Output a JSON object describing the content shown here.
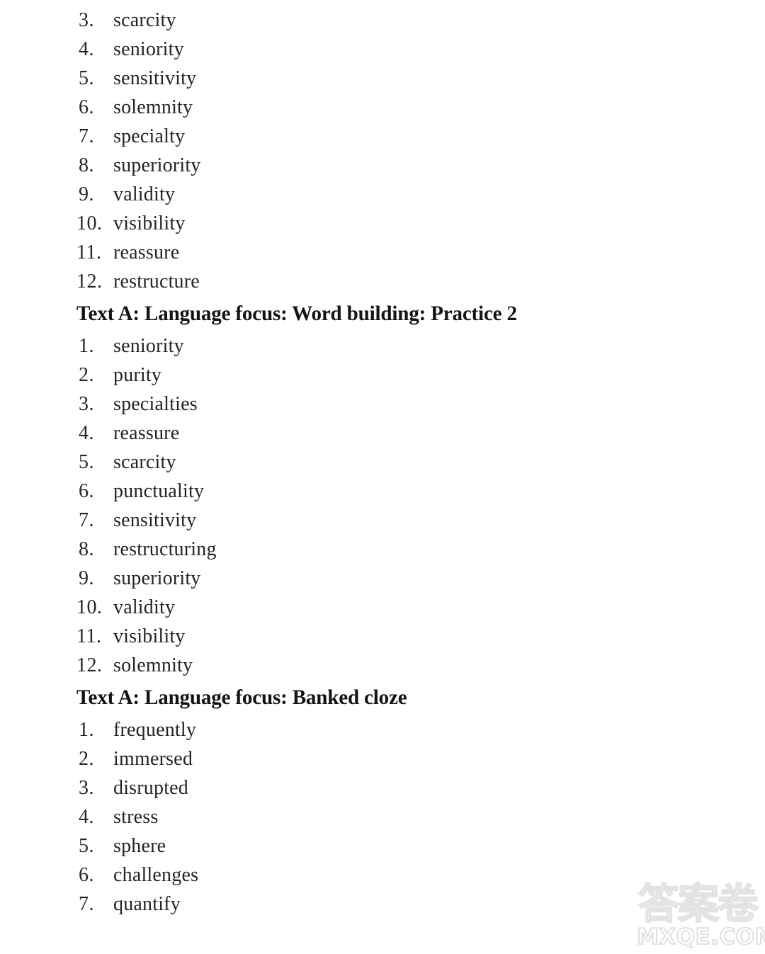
{
  "document": {
    "background_color": "#ffffff",
    "text_color": "#242424"
  },
  "blocks": [
    {
      "type": "list",
      "name": "word-building-practice-1-continued",
      "items": [
        {
          "number": "3.",
          "word": "scarcity"
        },
        {
          "number": "4.",
          "word": "seniority"
        },
        {
          "number": "5.",
          "word": "sensitivity"
        },
        {
          "number": "6.",
          "word": "solemnity"
        },
        {
          "number": "7.",
          "word": "specialty"
        },
        {
          "number": "8.",
          "word": "superiority"
        },
        {
          "number": "9.",
          "word": "validity"
        },
        {
          "number": "10.",
          "word": "visibility"
        },
        {
          "number": "11.",
          "word": "reassure"
        },
        {
          "number": "12.",
          "word": "restructure"
        }
      ]
    },
    {
      "type": "heading",
      "name": "heading-word-building-practice-2",
      "text": "Text A: Language focus: Word building: Practice 2"
    },
    {
      "type": "list",
      "name": "word-building-practice-2-answers",
      "items": [
        {
          "number": "1.",
          "word": "seniority"
        },
        {
          "number": "2.",
          "word": "purity"
        },
        {
          "number": "3.",
          "word": "specialties"
        },
        {
          "number": "4.",
          "word": "reassure"
        },
        {
          "number": "5.",
          "word": "scarcity"
        },
        {
          "number": "6.",
          "word": "punctuality"
        },
        {
          "number": "7.",
          "word": "sensitivity"
        },
        {
          "number": "8.",
          "word": "restructuring"
        },
        {
          "number": "9.",
          "word": "superiority"
        },
        {
          "number": "10.",
          "word": "validity"
        },
        {
          "number": "11.",
          "word": "visibility"
        },
        {
          "number": "12.",
          "word": "solemnity"
        }
      ]
    },
    {
      "type": "heading",
      "name": "heading-banked-cloze",
      "text": "Text A: Language focus: Banked cloze"
    },
    {
      "type": "list",
      "name": "banked-cloze-answers",
      "items": [
        {
          "number": "1.",
          "word": "frequently"
        },
        {
          "number": "2.",
          "word": "immersed"
        },
        {
          "number": "3.",
          "word": "disrupted"
        },
        {
          "number": "4.",
          "word": "stress"
        },
        {
          "number": "5.",
          "word": "sphere"
        },
        {
          "number": "6.",
          "word": "challenges"
        },
        {
          "number": "7.",
          "word": "quantify"
        }
      ]
    }
  ],
  "watermark": {
    "cjk_text": "答案卷",
    "domain_text": "MXQE.COM",
    "color": "#e3e3e3"
  }
}
